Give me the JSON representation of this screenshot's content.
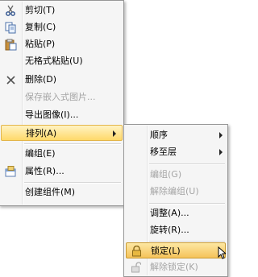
{
  "main_menu": {
    "items": [
      {
        "label": "剪切(T)",
        "icon": "scissors-icon"
      },
      {
        "label": "复制(C)",
        "icon": "copy-icon"
      },
      {
        "label": "粘贴(P)",
        "icon": "paste-icon"
      },
      {
        "label": "无格式粘贴(U)"
      },
      {
        "label": "删除(D)",
        "icon": "delete-x-icon"
      },
      {
        "label": "保存嵌入式图片..."
      },
      {
        "label": "导出图像(I)..."
      },
      {
        "label": "排列(A)"
      },
      {
        "label": "编组(E)",
        "icon": "group-icon"
      },
      {
        "label": "属性(R)...",
        "icon": "properties-icon"
      },
      {
        "label": "创建组件(M)"
      }
    ]
  },
  "arrange_submenu": {
    "items": [
      {
        "label": "顺序"
      },
      {
        "label": "移至层"
      },
      {
        "label": "编组(G)"
      },
      {
        "label": "解除编组(U)"
      },
      {
        "label": "调整(A)..."
      },
      {
        "label": "旋转(R)..."
      },
      {
        "label": "锁定(L)",
        "icon": "lock-icon"
      },
      {
        "label": "解除锁定(K)",
        "icon": "unlock-icon"
      }
    ]
  },
  "colors": {
    "highlight": "#ffd96a",
    "disabled_text": "#a5a5a5"
  }
}
